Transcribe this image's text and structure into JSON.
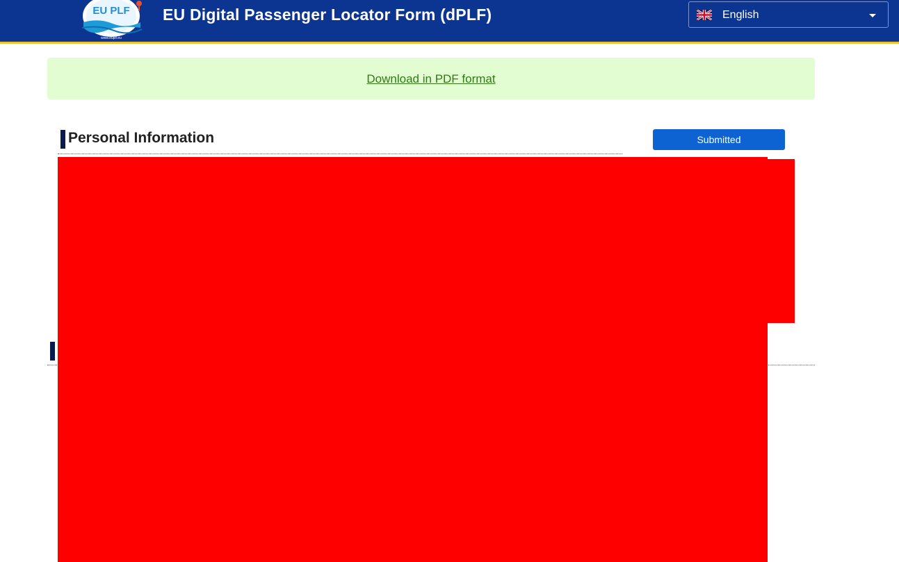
{
  "header": {
    "logo_text": "EU PLF",
    "logo_url_text": "www.euplf.eu",
    "title": "EU Digital Passenger Locator Form (dPLF)",
    "language": {
      "selected": "English",
      "flag_icon": "uk-flag-icon"
    }
  },
  "download": {
    "label": "Download in PDF format"
  },
  "section": {
    "title": "Personal Information",
    "status_label": "Submitted"
  },
  "colors": {
    "header_bg": "#0c3491",
    "header_accent": "#f2c231",
    "download_bg": "#e3fdd2",
    "link": "#2f7a13",
    "status_button": "#0d63d2",
    "redaction": "#ff0000"
  }
}
